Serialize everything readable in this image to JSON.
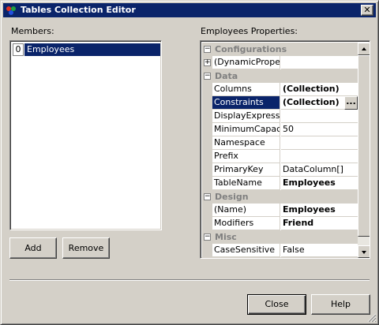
{
  "window": {
    "title": "Tables Collection Editor",
    "close_glyph": "✕"
  },
  "members": {
    "label": "Members:",
    "items": [
      {
        "index": "0",
        "name": "Employees",
        "selected": true
      }
    ],
    "add_label": "Add",
    "remove_label": "Remove"
  },
  "properties": {
    "label": "Employees Properties:",
    "categories": [
      {
        "name": "Configurations",
        "expanded": true,
        "rows": [
          {
            "name": "(DynamicProperti",
            "value": "",
            "expandable": true
          }
        ]
      },
      {
        "name": "Data",
        "expanded": true,
        "rows": [
          {
            "name": "Columns",
            "value": "(Collection)",
            "bold": true
          },
          {
            "name": "Constraints",
            "value": "(Collection)",
            "bold": true,
            "selected": true,
            "ellipsis": "..."
          },
          {
            "name": "DisplayExpression",
            "value": ""
          },
          {
            "name": "MinimumCapacity",
            "value": "50"
          },
          {
            "name": "Namespace",
            "value": ""
          },
          {
            "name": "Prefix",
            "value": ""
          },
          {
            "name": "PrimaryKey",
            "value": "DataColumn[]"
          },
          {
            "name": "TableName",
            "value": "Employees",
            "bold": true
          }
        ]
      },
      {
        "name": "Design",
        "expanded": true,
        "rows": [
          {
            "name": "(Name)",
            "value": "Employees",
            "bold": true
          },
          {
            "name": "Modifiers",
            "value": "Friend",
            "bold": true
          }
        ]
      },
      {
        "name": "Misc",
        "expanded": true,
        "rows": [
          {
            "name": "CaseSensitive",
            "value": "False"
          }
        ]
      }
    ],
    "expand_glyph": "+",
    "collapse_glyph": "−"
  },
  "footer": {
    "close_label": "Close",
    "help_label": "Help"
  },
  "colors": {
    "titlebar": "#0a246a",
    "selection": "#0a246a",
    "face": "#d4d0c8",
    "category_text": "#808080"
  }
}
